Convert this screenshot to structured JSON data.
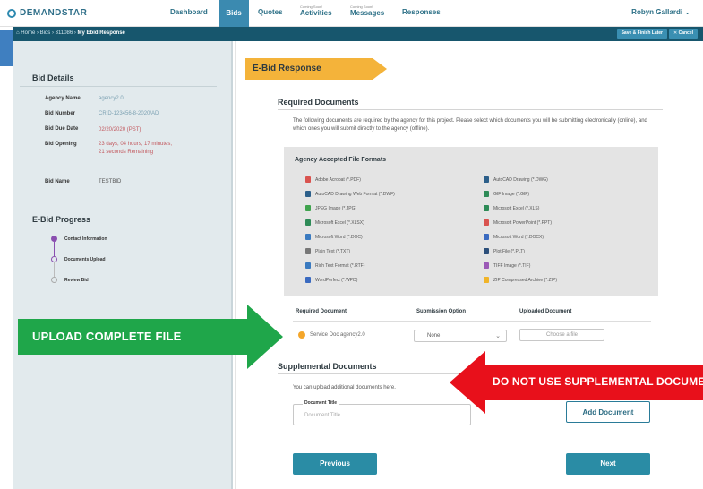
{
  "nav": {
    "brand": "DEMANDSTAR",
    "items": [
      {
        "label": "Dashboard"
      },
      {
        "label": "Bids"
      },
      {
        "label": "Quotes"
      },
      {
        "sub": "Coming Soon!",
        "label": "Activities"
      },
      {
        "sub": "Coming Soon!",
        "label": "Messages"
      },
      {
        "label": "Responses"
      }
    ],
    "user": "Robyn Gallardi ⌄"
  },
  "breadcrumb": {
    "path": "⌂ Home › Bids › 311086 › ",
    "current": "My Ebid Response",
    "save_label": "Save & Finish Later",
    "cancel_label": "✕ Cancel"
  },
  "sidebar": {
    "details_title": "Bid Details",
    "details": [
      {
        "term": "Agency Name",
        "value": "agency2.0"
      },
      {
        "term": "Bid Number",
        "value": "CRID-123456-8-2020/AD"
      },
      {
        "term": "Bid Due Date",
        "value": "02/20/2020 (PST)"
      },
      {
        "term": "Bid Opening",
        "value": "23 days, 04 hours, 17 minutes, 21 seconds Remaining"
      },
      {
        "term": "Bid Name",
        "value": "TESTBID"
      }
    ],
    "progress_title": "E-Bid Progress",
    "progress": [
      {
        "label": "Contact Information"
      },
      {
        "label": "Documents Upload"
      },
      {
        "label": "Review Bid"
      }
    ]
  },
  "main": {
    "banner": "E-Bid Response",
    "required_title": "Required Documents",
    "required_text": "The following documents are required by the agency for this project. Please select which documents you will be submitting electronically (online), and which ones you will submit directly to the agency (offline).",
    "formats_title": "Agency Accepted File Formats",
    "formats_left": [
      {
        "label": "Adobe Acrobat (*.PDF)",
        "color": "#d9534f"
      },
      {
        "label": "AutoCAD Drawing Web Format (*.DWF)",
        "color": "#2c5f8a"
      },
      {
        "label": "JPEG Image (*.JPG)",
        "color": "#3fa34d"
      },
      {
        "label": "Microsoft Excel (*.XLSX)",
        "color": "#2e8b57"
      },
      {
        "label": "Microsoft Word (*.DOC)",
        "color": "#3a7ac0"
      },
      {
        "label": "Plain Text (*.TXT)",
        "color": "#777777"
      },
      {
        "label": "Rich Text Format (*.RTF)",
        "color": "#3a7ac0"
      },
      {
        "label": "WordPerfect (*.WPD)",
        "color": "#3a6ac0"
      }
    ],
    "formats_right": [
      {
        "label": "AutoCAD Drawing (*.DWG)",
        "color": "#2c5f8a"
      },
      {
        "label": "GIF Image (*.GIF)",
        "color": "#2e8b57"
      },
      {
        "label": "Microsoft Excel (*.XLS)",
        "color": "#2e8b57"
      },
      {
        "label": "Microsoft PowerPoint (*.PPT)",
        "color": "#d9534f"
      },
      {
        "label": "Microsoft Word (*.DOCX)",
        "color": "#3a6ac0"
      },
      {
        "label": "Plot File (*.PLT)",
        "color": "#2c4f7a"
      },
      {
        "label": "TIFF Image (*.TIF)",
        "color": "#9b59b6"
      },
      {
        "label": "ZIP Compressed Archive (*.ZIP)",
        "color": "#f0b429"
      }
    ],
    "table": {
      "col_doc": "Required Document",
      "col_option": "Submission Option",
      "col_upload": "Uploaded Document",
      "doc_name": "Service Doc agency2.0",
      "option_value": "None",
      "choose_label": "Choose a file"
    },
    "supp_title": "Supplemental Documents",
    "supp_text": "You can upload additional documents here.",
    "doc_title_label": "Document Title",
    "doc_title_placeholder": "Document Title",
    "add_doc_label": "Add Document",
    "prev_label": "Previous",
    "next_label": "Next"
  },
  "annotations": {
    "green_text": "UPLOAD COMPLETE  FILE",
    "red_text": "DO NOT USE SUPPLEMENTAL DOCUMENTS",
    "green_color": "#1fa64a",
    "red_color": "#e8101b"
  }
}
